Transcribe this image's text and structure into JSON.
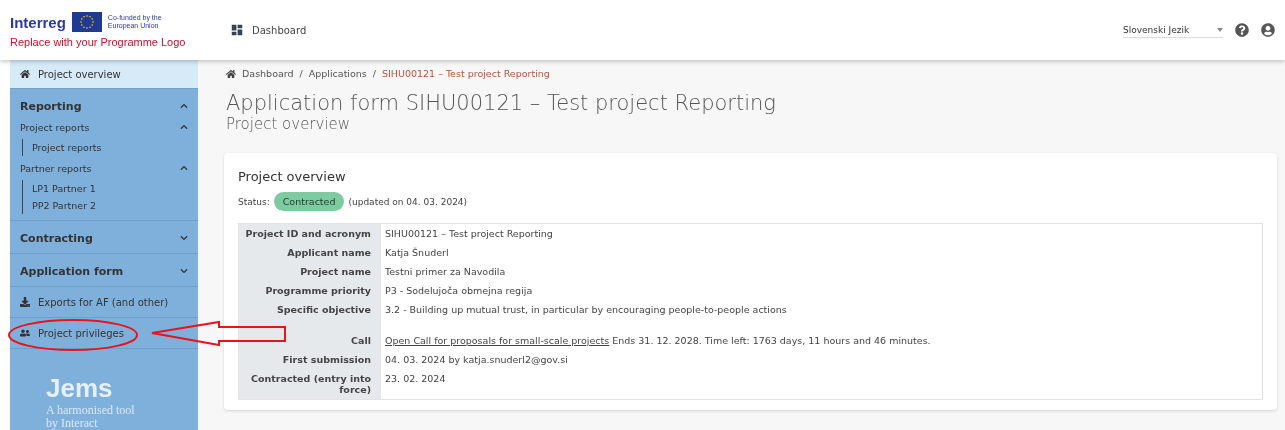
{
  "header": {
    "brand": "Interreg",
    "eu_label": "Co-funded by the European Union",
    "logo_note": "Replace with your Programme Logo",
    "dashboard": "Dashboard",
    "language": "Slovenski Jezik"
  },
  "sidebar": {
    "items": [
      {
        "kind": "link",
        "label": "Project overview",
        "selected": true
      },
      {
        "kind": "section",
        "label": "Reporting",
        "expanded": true,
        "children": [
          {
            "label": "Project reports",
            "expanded": true,
            "children": [
              {
                "label": "Project reports"
              }
            ]
          },
          {
            "label": "Partner reports",
            "expanded": true,
            "children": [
              {
                "label": "LP1 Partner 1"
              },
              {
                "label": "PP2 Partner 2"
              }
            ]
          }
        ]
      },
      {
        "kind": "section",
        "label": "Contracting",
        "expanded": false
      },
      {
        "kind": "section",
        "label": "Application form",
        "expanded": false
      },
      {
        "kind": "link",
        "label": "Exports for AF (and other)",
        "selected": false
      },
      {
        "kind": "link",
        "label": "Project privileges",
        "selected": false,
        "highlighted": true
      }
    ],
    "footer": {
      "logo": "Jems",
      "tagline": "A harmonised tool",
      "by": "by Interact"
    }
  },
  "breadcrumb": [
    {
      "kind": "link",
      "text": "Dashboard"
    },
    {
      "kind": "separator",
      "text": "/"
    },
    {
      "kind": "link",
      "text": "Applications"
    },
    {
      "kind": "separator",
      "text": "/"
    },
    {
      "kind": "current",
      "text": "SIHU00121 – Test project Reporting"
    }
  ],
  "title": "Application form SIHU00121 – Test project Reporting",
  "subtitle": "Project overview",
  "card": {
    "title": "Project overview",
    "status_label": "Status:",
    "status": "Contracted",
    "status_note": "(updated on 04. 03. 2024)",
    "rows": [
      {
        "label": "Project ID and acronym",
        "value": "SIHU00121 – Test project Reporting"
      },
      {
        "label": "Applicant name",
        "value": "Katja Šnuderl"
      },
      {
        "label": "Project name",
        "value": "Testni primer za Navodila"
      },
      {
        "label": "Programme priority",
        "value": "P3 - Sodelujoča obmejna regija"
      },
      {
        "label": "Specific objective",
        "value": "3.2 - Building up mutual trust, in particular by encouraging people-to-people actions"
      },
      {
        "label": "Call",
        "link": "Open Call for proposals for small-scale projects",
        "value": "Ends 31. 12. 2028. Time left: 1763 days, 11 hours and 46 minutes.",
        "spaced": true
      },
      {
        "label": "First submission",
        "value": "04. 03. 2024 by katja.snuderl2@gov.si"
      },
      {
        "label": "Contracted (entry into force)",
        "value": "23. 02. 2024"
      }
    ]
  }
}
